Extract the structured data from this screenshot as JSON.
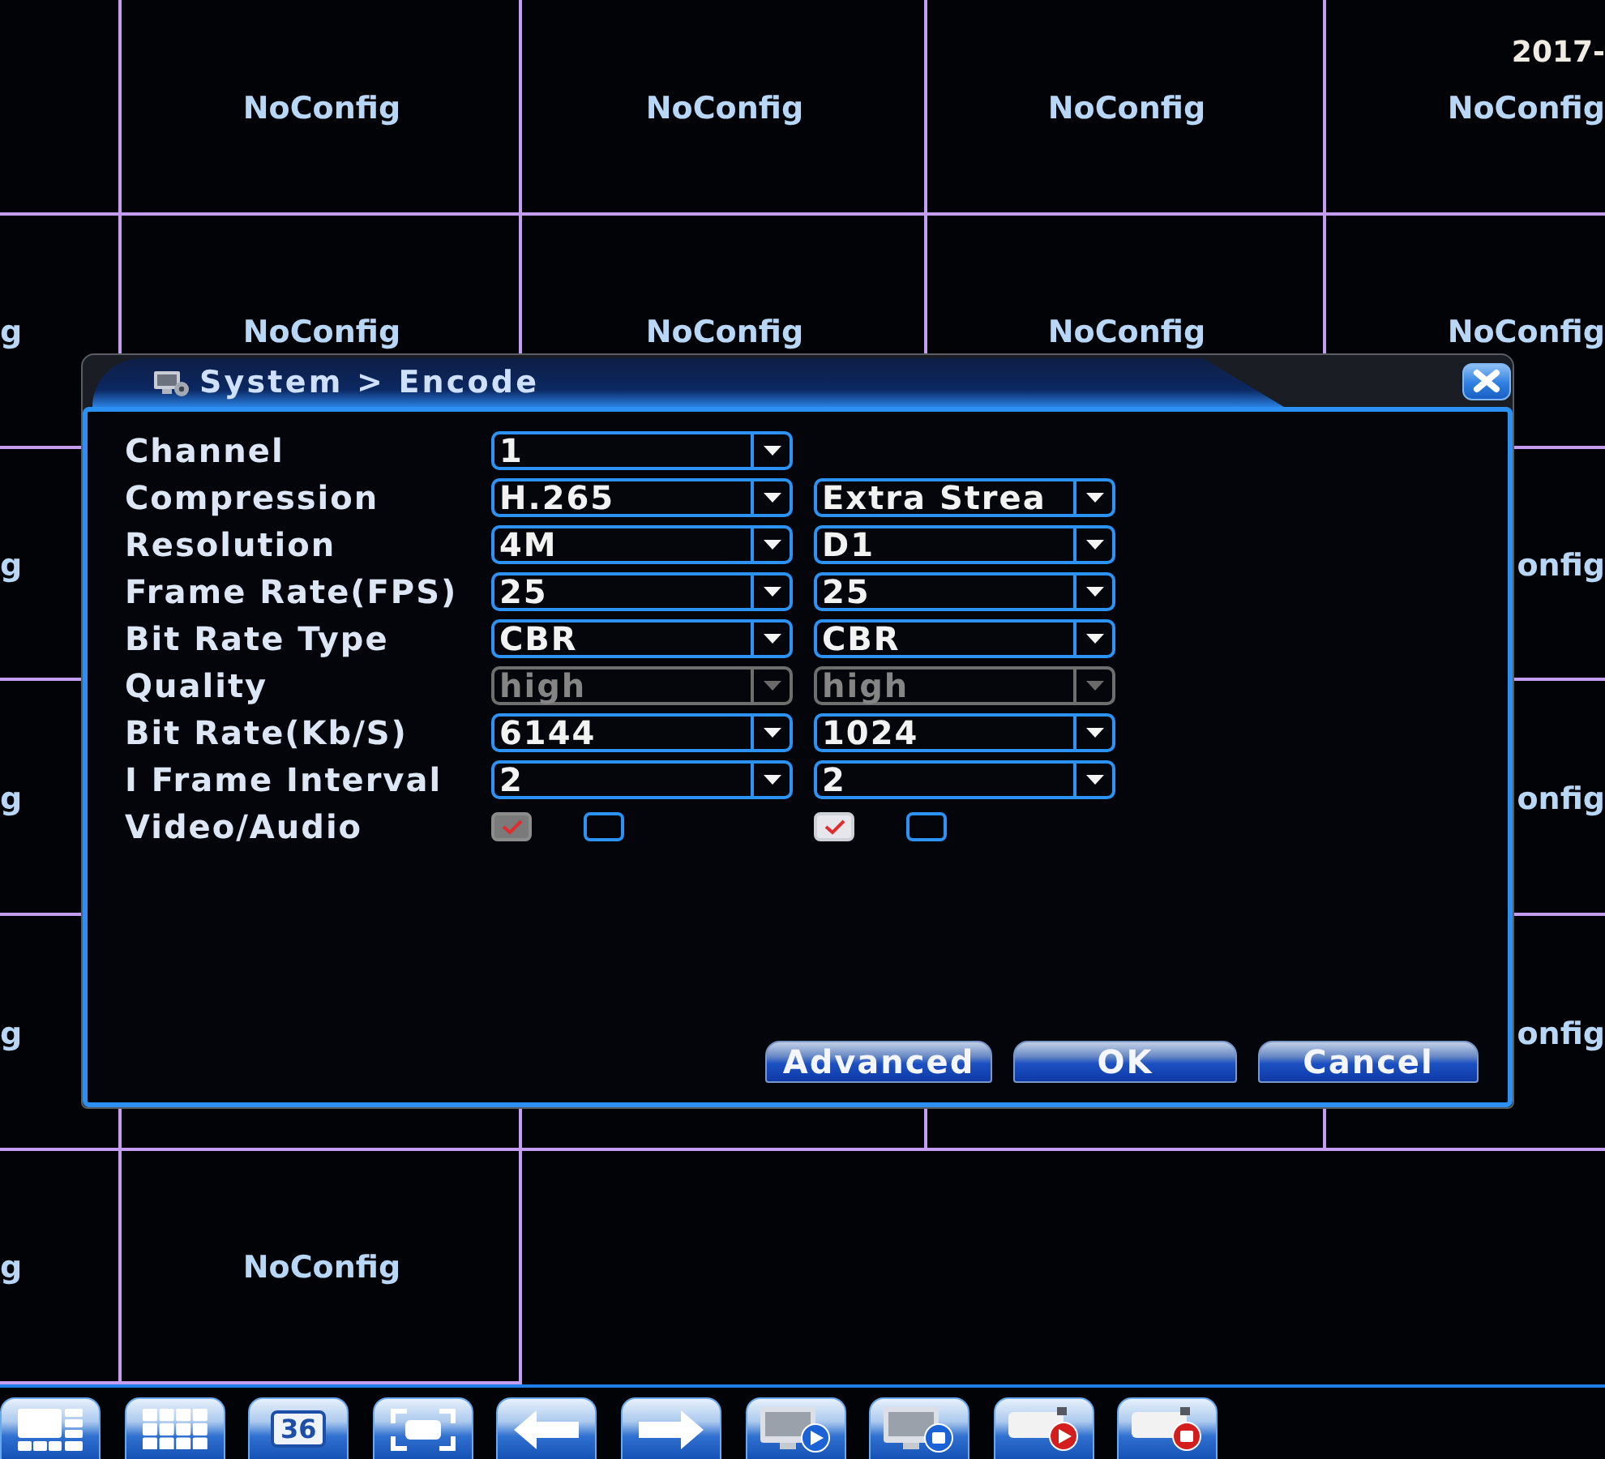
{
  "camera_grid": {
    "rows": [
      {
        "tiles": [
          "NoConfig",
          "NoConfig",
          "NoConfig"
        ],
        "right_edge": {
          "timestamp": "2017-",
          "label": "NoConfig"
        }
      },
      {
        "left_edge": "g",
        "tiles": [
          "NoConfig",
          "NoConfig",
          "NoConfig"
        ],
        "right_edge": {
          "label": "NoConfig"
        }
      },
      {
        "left_edge": "g",
        "right_edge": {
          "label": "onfig"
        }
      },
      {
        "left_edge": "g",
        "right_edge": {
          "label": "onfig"
        }
      },
      {
        "left_edge": "g",
        "right_edge": {
          "label": "onfig"
        }
      },
      {
        "left_edge": "g",
        "tiles": [
          "NoConfig"
        ]
      }
    ]
  },
  "dialog": {
    "title": "System > Encode",
    "rows": [
      {
        "label": "Channel",
        "main": {
          "kind": "dropdown",
          "value": "1",
          "disabled": false
        }
      },
      {
        "label": "Compression",
        "main": {
          "kind": "dropdown",
          "value": "H.265",
          "disabled": false
        },
        "extra": {
          "kind": "dropdown",
          "value": "Extra Strea",
          "disabled": false
        }
      },
      {
        "label": "Resolution",
        "main": {
          "kind": "dropdown",
          "value": "4M",
          "disabled": false
        },
        "extra": {
          "kind": "dropdown",
          "value": "D1",
          "disabled": false
        }
      },
      {
        "label": "Frame Rate(FPS)",
        "main": {
          "kind": "dropdown",
          "value": "25",
          "disabled": false
        },
        "extra": {
          "kind": "dropdown",
          "value": "25",
          "disabled": false
        }
      },
      {
        "label": "Bit Rate Type",
        "main": {
          "kind": "dropdown",
          "value": "CBR",
          "disabled": false
        },
        "extra": {
          "kind": "dropdown",
          "value": "CBR",
          "disabled": false
        }
      },
      {
        "label": "Quality",
        "main": {
          "kind": "dropdown",
          "value": "high",
          "disabled": true
        },
        "extra": {
          "kind": "dropdown",
          "value": "high",
          "disabled": true
        }
      },
      {
        "label": "Bit Rate(Kb/S)",
        "main": {
          "kind": "dropdown",
          "value": "6144",
          "disabled": false
        },
        "extra": {
          "kind": "dropdown",
          "value": "1024",
          "disabled": false
        }
      },
      {
        "label": "I Frame Interval",
        "main": {
          "kind": "dropdown",
          "value": "2",
          "disabled": false
        },
        "extra": {
          "kind": "dropdown",
          "value": "2",
          "disabled": false
        }
      },
      {
        "label": "Video/Audio",
        "main": {
          "kind": "checkbox_pair",
          "checks": [
            {
              "checked": true,
              "disabled": true
            },
            {
              "checked": false,
              "disabled": false
            }
          ]
        },
        "extra": {
          "kind": "checkbox_pair",
          "checks": [
            {
              "checked": true,
              "disabled": false
            },
            {
              "checked": false,
              "disabled": false
            }
          ]
        }
      }
    ],
    "buttons": [
      {
        "label": "Advanced"
      },
      {
        "label": "OK"
      },
      {
        "label": "Cancel"
      }
    ]
  },
  "toolbar": {
    "buttons": [
      {
        "kind": "split"
      },
      {
        "kind": "grid"
      },
      {
        "kind": "count",
        "label": "36"
      },
      {
        "kind": "fullscreen"
      },
      {
        "kind": "previous"
      },
      {
        "kind": "next"
      },
      {
        "kind": "playback"
      },
      {
        "kind": "playback_stop"
      },
      {
        "kind": "record"
      },
      {
        "kind": "record_stop"
      }
    ]
  }
}
